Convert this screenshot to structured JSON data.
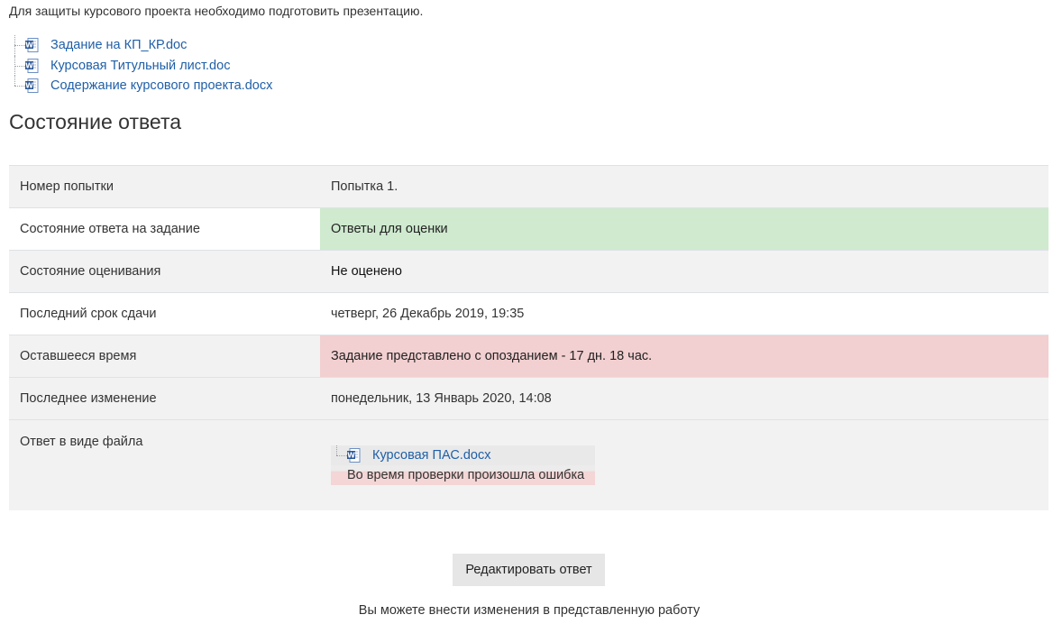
{
  "intro_text": "Для защиты курсового проекта необходимо подготовить презентацию.",
  "attachments": [
    {
      "name": "Задание на КП_КР.doc",
      "icon": "word-document-icon"
    },
    {
      "name": "Курсовая Титульный лист.doc",
      "icon": "word-document-icon"
    },
    {
      "name": "Содержание курсового проекта.docx",
      "icon": "word-document-icon"
    }
  ],
  "section_title": "Состояние ответа",
  "status_rows": [
    {
      "label": "Номер попытки",
      "value": "Попытка 1."
    },
    {
      "label": "Состояние ответа на задание",
      "value": "Ответы для оценки",
      "status": "success"
    },
    {
      "label": "Состояние оценивания",
      "value": "Не оценено"
    },
    {
      "label": "Последний срок сдачи",
      "value": "четверг, 26 Декабрь 2019, 19:35"
    },
    {
      "label": "Оставшееся время",
      "value": "Задание представлено с опозданием - 17 дн. 18 час.",
      "status": "danger"
    },
    {
      "label": "Последнее изменение",
      "value": "понедельник, 13 Январь 2020, 14:08"
    },
    {
      "label": "Ответ в виде файла"
    }
  ],
  "submission": {
    "file_name": "Курсовая ПАС.docx",
    "file_icon": "word-document-icon",
    "error_text": "Во время проверки произошла ошибка"
  },
  "edit_button_label": "Редактировать ответ",
  "hint_text": "Вы можете внести изменения в представленную работу",
  "colors": {
    "link": "#1f5fa8",
    "success_bg": "#cfeacf",
    "danger_bg": "#f2cfd0",
    "stripe_bg": "#f2f2f2",
    "button_bg": "#e6e6e6"
  }
}
